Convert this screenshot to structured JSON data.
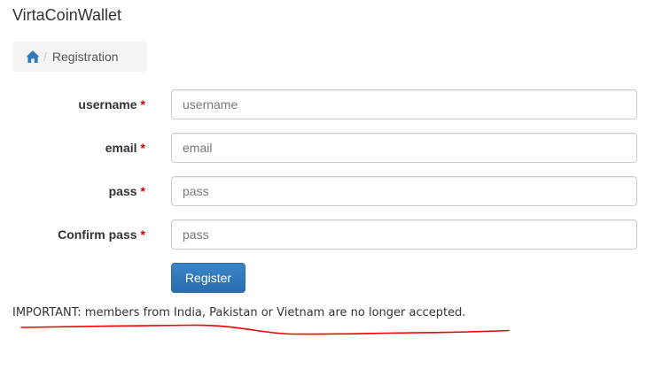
{
  "brand": {
    "title": "VirtaCoinWallet"
  },
  "breadcrumb": {
    "home_icon": "home-icon",
    "separator": "/",
    "current": "Registration"
  },
  "form": {
    "fields": [
      {
        "label": "username",
        "required_mark": "*",
        "placeholder": "username",
        "value": ""
      },
      {
        "label": "email",
        "required_mark": "*",
        "placeholder": "email",
        "value": ""
      },
      {
        "label": "pass",
        "required_mark": "*",
        "placeholder": "pass",
        "value": ""
      },
      {
        "label": "Confirm pass",
        "required_mark": "*",
        "placeholder": "pass",
        "value": ""
      }
    ],
    "submit_label": "Register"
  },
  "notice": {
    "text": "IMPORTANT: members from India, Pakistan or Vietnam are no longer accepted."
  },
  "colors": {
    "required": "#cc0000",
    "primary_button": "#337ab7",
    "annotation_underline": "#ee0000",
    "home_icon": "#337ab7"
  }
}
